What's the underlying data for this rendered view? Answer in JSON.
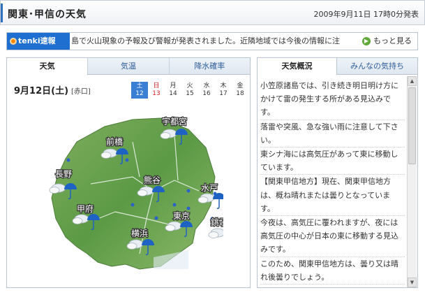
{
  "header": {
    "title": "関東･甲信の天気",
    "timestamp": "2009年9月11日 17時0分発表"
  },
  "ticker": {
    "badge": "tenki速報",
    "message": "島で火山現象の予報及び警報が発表されました。近隣地域では今後の情報に注",
    "more_label": "もっと見る"
  },
  "left_tabs": [
    "天気",
    "気温",
    "降水確率"
  ],
  "forecast": {
    "date": "9月12日(土)",
    "rokuyo": "[赤口]",
    "calendar": [
      {
        "dow": "土",
        "num": "12",
        "selected": true,
        "sunday": false
      },
      {
        "dow": "日",
        "num": "13",
        "selected": false,
        "sunday": true
      },
      {
        "dow": "月",
        "num": "14",
        "selected": false,
        "sunday": false
      },
      {
        "dow": "火",
        "num": "15",
        "selected": false,
        "sunday": false
      },
      {
        "dow": "水",
        "num": "16",
        "selected": false,
        "sunday": false
      },
      {
        "dow": "木",
        "num": "17",
        "selected": false,
        "sunday": false
      },
      {
        "dow": "金",
        "num": "18",
        "selected": false,
        "sunday": false
      }
    ]
  },
  "map": {
    "cities": [
      "宇都宮",
      "前橋",
      "長野",
      "熊谷",
      "水戸",
      "甲府",
      "東京",
      "銚子",
      "横浜"
    ],
    "icon": "cloudy-with-rain-icon"
  },
  "right_tabs": [
    "天気概況",
    "みんなの気持ち"
  ],
  "overview": [
    "小笠原諸島では、引き続き明日明け方にかけて雷の発生する所がある見込みです。",
    "落雷や突風、急な強い雨に注意して下さい。",
    "東シナ海には高気圧があって東に移動しています。",
    "【関東甲信地方】現在、関東甲信地方は、概ね晴れまたは曇りとなっています。",
    "今夜は、高気圧に覆われますが、夜には高気圧の中心が日本の東に移動する見込みです。",
    "このため、関東甲信地方は、曇り又は晴れ後曇りでしょう。"
  ],
  "colors": {
    "accent": "#1e6fd0",
    "map_green": "#5c9a46",
    "sunday": "#d02020"
  }
}
